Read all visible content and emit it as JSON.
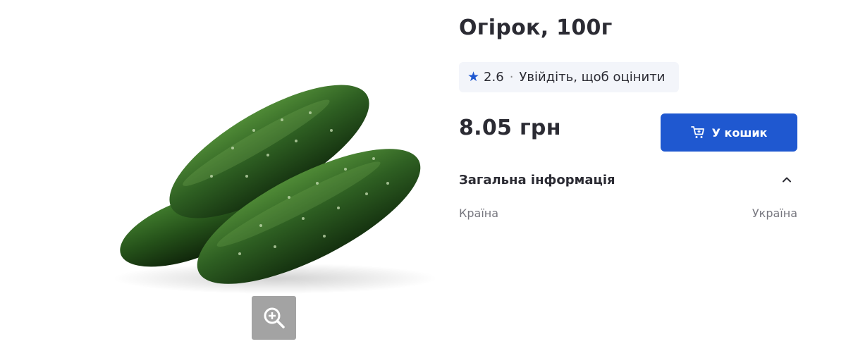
{
  "product": {
    "title": "Огірок, 100г",
    "image_icon": "cucumber-image"
  },
  "rating": {
    "value": "2.6",
    "separator": "·",
    "login_prompt": "Увійдіть, щоб оцінити",
    "icon": "star-icon",
    "color": "#1f58d0"
  },
  "price": {
    "text": "8.05 грн"
  },
  "cart_button": {
    "label": "У кошик",
    "icon": "cart-add-icon",
    "color": "#1f58d0"
  },
  "info_section": {
    "title": "Загальна інформація",
    "toggle_icon": "chevron-up-icon",
    "rows": [
      {
        "label": "Країна",
        "value": "Україна"
      }
    ]
  },
  "zoom_button": {
    "icon": "zoom-in-icon"
  }
}
